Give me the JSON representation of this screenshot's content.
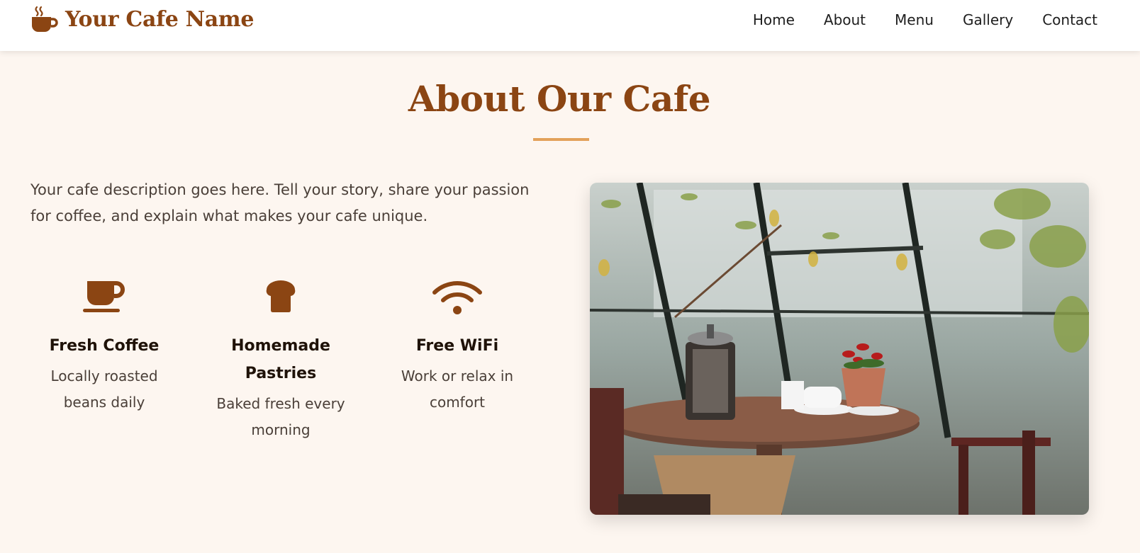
{
  "header": {
    "brand_name": "Your Cafe Name",
    "brand_icon": "coffee-cup-icon",
    "nav": [
      "Home",
      "About",
      "Menu",
      "Gallery",
      "Contact"
    ]
  },
  "about": {
    "title": "About Our Cafe",
    "description": "Your cafe description goes here. Tell your story, share your passion for coffee, and explain what makes your cafe unique.",
    "features": [
      {
        "icon": "coffee-cup-icon",
        "title": "Fresh Coffee",
        "text": "Locally roasted beans daily"
      },
      {
        "icon": "bread-icon",
        "title": "Homemade Pastries",
        "text": "Baked fresh every morning"
      },
      {
        "icon": "wifi-icon",
        "title": "Free WiFi",
        "text": "Work or relax in comfort"
      }
    ],
    "image": "cafe-interior-photo"
  },
  "colors": {
    "brand": "#8b4513",
    "accent": "#e3a15a",
    "background": "#fdf6f0",
    "header_bg": "#ffffff"
  }
}
